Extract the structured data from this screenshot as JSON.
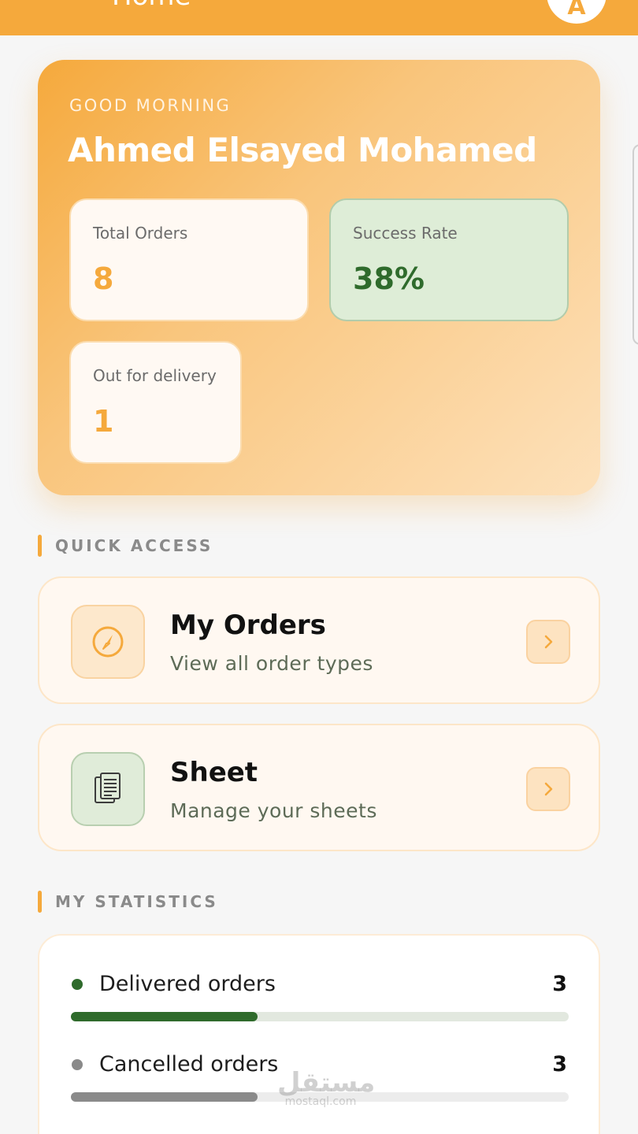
{
  "app_bar": {
    "title": "Home",
    "avatar_initial": "A"
  },
  "greeting": {
    "salutation": "GOOD MORNING",
    "user_name": "Ahmed Elsayed Mohamed"
  },
  "summary": {
    "total_orders": {
      "label": "Total Orders",
      "value": "8"
    },
    "success_rate": {
      "label": "Success Rate",
      "value": "38%"
    },
    "out_for_delivery": {
      "label": "Out for delivery",
      "value": "1"
    }
  },
  "quick_access": {
    "title": "QUICK ACCESS",
    "items": [
      {
        "title": "My Orders",
        "subtitle": "View all order types",
        "icon": "compass-icon"
      },
      {
        "title": "Sheet",
        "subtitle": "Manage your sheets",
        "icon": "document-icon"
      }
    ]
  },
  "statistics": {
    "title": "MY STATISTICS",
    "rows": [
      {
        "label": "Delivered orders",
        "value": "3",
        "progress": 0.375,
        "color": "#2f6b2c"
      },
      {
        "label": "Cancelled orders",
        "value": "3",
        "progress": 0.375,
        "color": "#8a8a8a"
      }
    ]
  },
  "colors": {
    "accent": "#f5a93c",
    "success": "#2f6b2c",
    "neutral": "#8a8a8a"
  },
  "watermark": {
    "main": "مستقل",
    "sub": "mostaql.com"
  }
}
